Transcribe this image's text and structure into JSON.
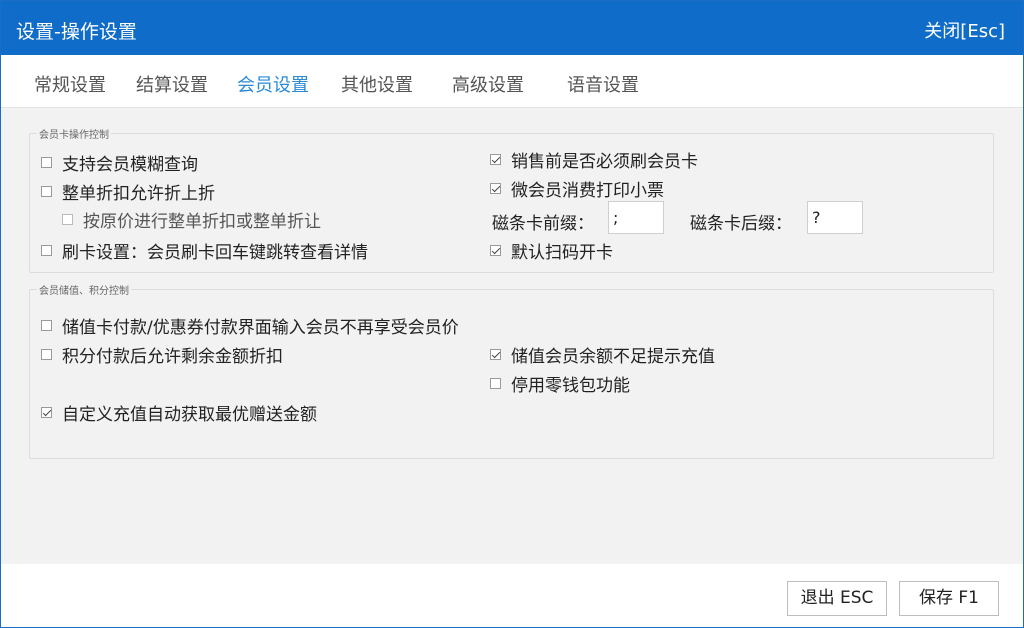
{
  "window": {
    "title": "设置-操作设置",
    "close_label": "关闭[Esc]"
  },
  "tabs": [
    {
      "label": "常规设置",
      "active": false
    },
    {
      "label": "结算设置",
      "active": false
    },
    {
      "label": "会员设置",
      "active": true
    },
    {
      "label": "其他设置",
      "active": false
    },
    {
      "label": "高级设置",
      "active": false
    },
    {
      "label": "语音设置",
      "active": false
    }
  ],
  "card_group": {
    "title": "会员卡操作控制",
    "fuzzy_query": {
      "label": "支持会员模糊查询",
      "checked": false
    },
    "discount_on_discount": {
      "label": "整单折扣允许折上折",
      "checked": false
    },
    "original_price_discount": {
      "label": "按原价进行整单折扣或整单折让",
      "checked": false
    },
    "swipe_setting": {
      "label": "刷卡设置：会员刷卡回车键跳转查看详情",
      "checked": false
    },
    "must_swipe_before_sale": {
      "label": "销售前是否必须刷会员卡",
      "checked": true
    },
    "wechat_print_receipt": {
      "label": "微会员消费打印小票",
      "checked": true
    },
    "prefix_label": "磁条卡前缀：",
    "prefix_value": ";",
    "suffix_label": "磁条卡后缀：",
    "suffix_value": "?",
    "default_scan_open": {
      "label": "默认扫码开卡",
      "checked": true
    }
  },
  "stored_group": {
    "title": "会员储值、积分控制",
    "stored_card_no_member_price": {
      "label": "储值卡付款/优惠券付款界面输入会员不再享受会员价",
      "checked": false
    },
    "points_allow_discount": {
      "label": "积分付款后允许剩余金额折扣",
      "checked": false
    },
    "low_balance_prompt": {
      "label": "储值会员余额不足提示充值",
      "checked": true
    },
    "disable_wallet": {
      "label": "停用零钱包功能",
      "checked": false
    },
    "auto_best_bonus": {
      "label": "自定义充值自动获取最优赠送金额",
      "checked": true
    }
  },
  "footer": {
    "exit_label": "退出 ESC",
    "save_label": "保存 F1"
  }
}
